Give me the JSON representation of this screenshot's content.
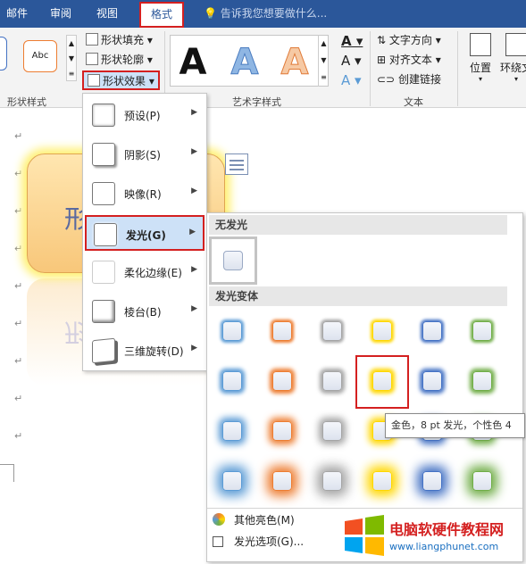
{
  "tabs": [
    {
      "label": "邮件"
    },
    {
      "label": "审阅"
    },
    {
      "label": "视图"
    },
    {
      "label": "格式"
    }
  ],
  "tell_me": "告诉我您想要做什么...",
  "ribbon": {
    "shape_styles": {
      "sample": "Abc",
      "group_label": "形状样式"
    },
    "shape_fill": "形状填充",
    "shape_outline": "形状轮廓",
    "shape_effects": "形状效果",
    "wordart": {
      "letter": "A",
      "group_label": "艺术字样式"
    },
    "text": {
      "direction": "文字方向",
      "align": "对齐文本",
      "link": "创建链接",
      "group_label": "文本"
    },
    "arrange": {
      "position": "位置",
      "wrap": "环绕文"
    }
  },
  "doc": {
    "shape_text": "形",
    "para_mark": "↵"
  },
  "effects_menu": {
    "items": [
      {
        "label": "预设(P)"
      },
      {
        "label": "阴影(S)"
      },
      {
        "label": "映像(R)"
      },
      {
        "label": "发光(G)"
      },
      {
        "label": "柔化边缘(E)"
      },
      {
        "label": "棱台(B)"
      },
      {
        "label": "三维旋转(D)"
      }
    ]
  },
  "glow_gallery": {
    "no_glow": "无发光",
    "variants": "发光变体",
    "more_colors": "其他亮色(M)",
    "options": "发光选项(G)...",
    "colors": [
      "#5b9bd5",
      "#ed7d31",
      "#a5a5a5",
      "#ffd700",
      "#4472c4",
      "#70ad47"
    ]
  },
  "tooltip": "金色，8 pt 发光，个性色 4",
  "watermark": {
    "title": "电脑软硬件教程网",
    "url": "www.liangphunet.com"
  }
}
